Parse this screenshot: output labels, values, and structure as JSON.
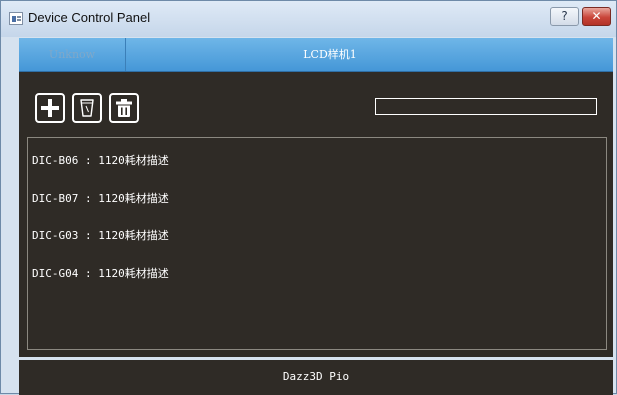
{
  "window": {
    "title": "Device Control Panel",
    "help_glyph": "?",
    "close_glyph": "✕"
  },
  "tabs": [
    {
      "label": "Unknow"
    },
    {
      "label": "LCD样机1"
    }
  ],
  "toolbar": {
    "add_icon": "plus-icon",
    "cup_icon": "cup-icon",
    "delete_icon": "trash-icon"
  },
  "progress": {
    "value": 0
  },
  "list": {
    "items": [
      {
        "text": "DIC-B06 : 1120耗材描述"
      },
      {
        "text": "DIC-B07 : 1120耗材描述"
      },
      {
        "text": "DIC-G03 : 1120耗材描述"
      },
      {
        "text": "DIC-G04 : 1120耗材描述"
      }
    ]
  },
  "status": {
    "text": "Dazz3D Pio"
  },
  "colors": {
    "panel": "#2f2b26",
    "tab_active": "#4a9ad8",
    "close": "#c9453a"
  }
}
